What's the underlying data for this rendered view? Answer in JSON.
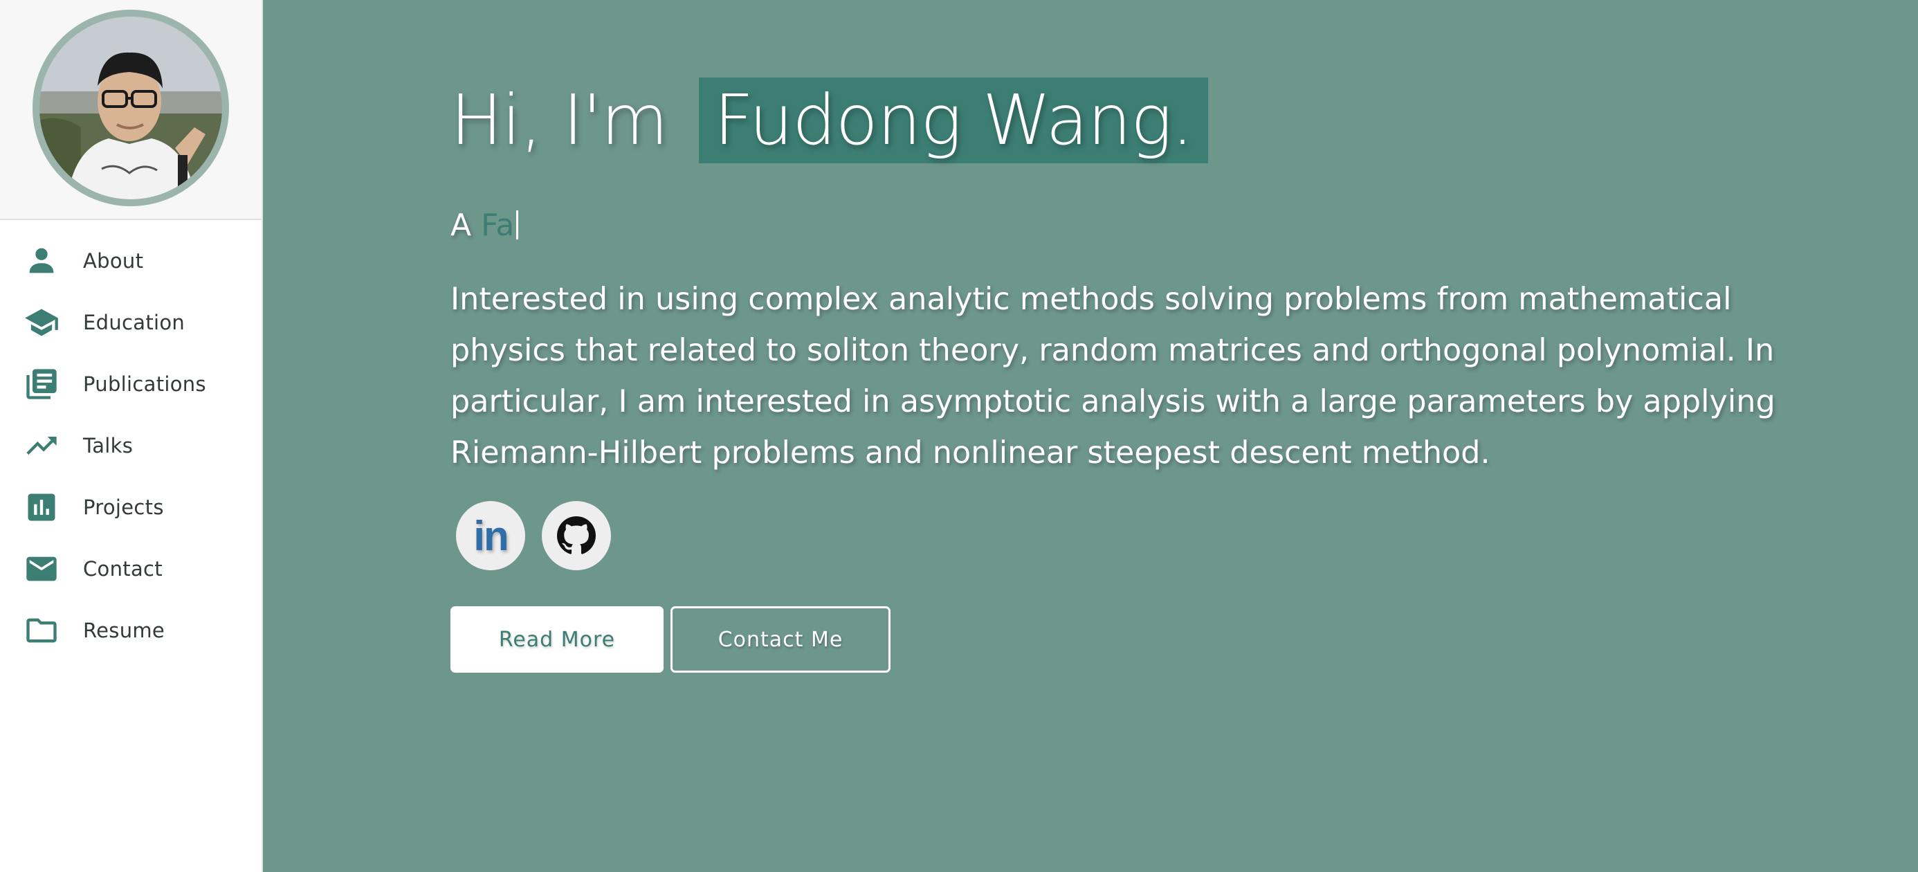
{
  "sidebar": {
    "avatar_alt": "Fudong Wang",
    "items": [
      {
        "label": "About",
        "icon": "person-icon"
      },
      {
        "label": "Education",
        "icon": "graduation-cap-icon"
      },
      {
        "label": "Publications",
        "icon": "library-books-icon"
      },
      {
        "label": "Talks",
        "icon": "trending-up-icon"
      },
      {
        "label": "Projects",
        "icon": "bar-chart-icon"
      },
      {
        "label": "Contact",
        "icon": "mail-icon"
      },
      {
        "label": "Resume",
        "icon": "folder-icon"
      }
    ]
  },
  "hero": {
    "greeting": "Hi, I'm",
    "name": "Fudong Wang.",
    "typed_prefix": "A",
    "typed_word": "Fa",
    "description": "Interested in using complex analytic methods solving problems from mathematical physics that related to soliton theory, random matrices and orthogonal polynomial. In particular, I am interested in asymptotic analysis with a large parameters by applying Riemann-Hilbert problems and nonlinear steepest descent method.",
    "social": [
      {
        "name": "linkedin",
        "label": "in"
      },
      {
        "name": "github"
      }
    ],
    "primary_button": "Read More",
    "secondary_button": "Contact Me"
  },
  "colors": {
    "accent": "#3c7e73",
    "background": "#6e978c",
    "sidebar": "#ffffff"
  }
}
